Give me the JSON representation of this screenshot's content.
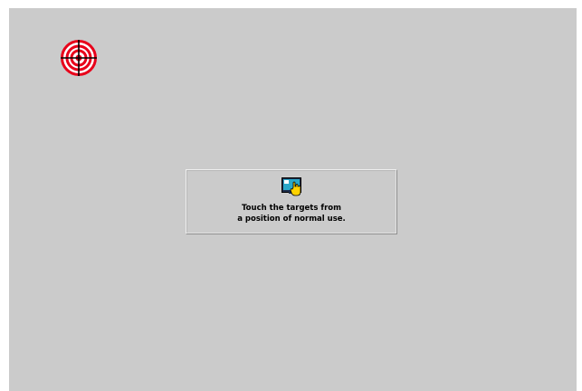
{
  "screen": {
    "background_color": "#cbcbcb"
  },
  "target": {
    "icon": "crosshair-target-icon",
    "ring_color": "#e8001a",
    "line_color": "#000000"
  },
  "instruction": {
    "icon": "touch-screen-hand-icon",
    "line1": "Touch the targets from",
    "line2": "a position of normal use."
  }
}
